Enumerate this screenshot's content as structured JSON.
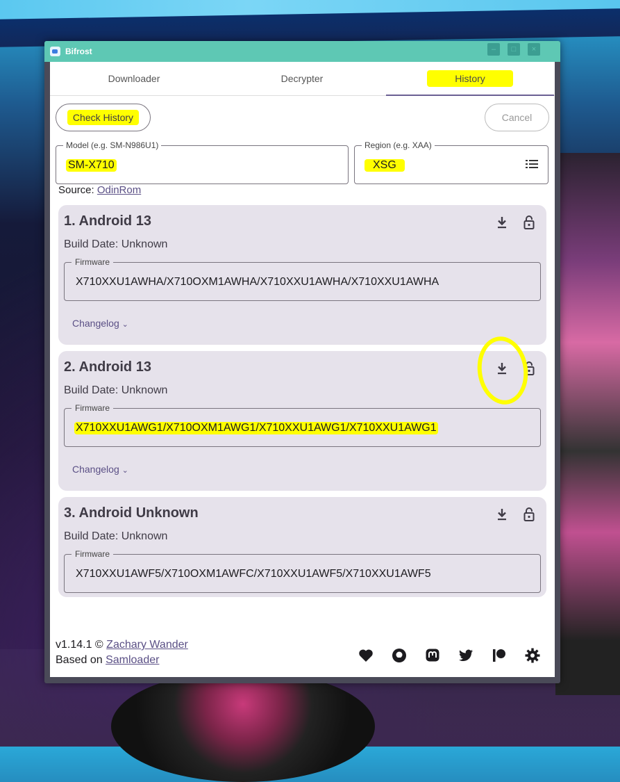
{
  "window": {
    "title": "Bifrost",
    "controls": [
      "minimize",
      "maximize",
      "close"
    ]
  },
  "tabs": [
    {
      "label": "Downloader"
    },
    {
      "label": "Decrypter"
    },
    {
      "label": "History",
      "active": true
    }
  ],
  "actions": {
    "check_history": "Check History",
    "cancel": "Cancel"
  },
  "model_field": {
    "legend": "Model (e.g. SM-N986U1)",
    "value": "SM-X710"
  },
  "region_field": {
    "legend": "Region (e.g. XAA)",
    "value": "XSG",
    "icon": "list-icon"
  },
  "source": {
    "label": "Source:",
    "link": "OdinRom"
  },
  "results": [
    {
      "title": "1. Android 13",
      "build_date": "Build Date: Unknown",
      "firmware_legend": "Firmware",
      "firmware": "X710XXU1AWHA/X710OXM1AWHA/X710XXU1AWHA/X710XXU1AWHA",
      "changelog": "Changelog"
    },
    {
      "title": "2. Android 13",
      "build_date": "Build Date: Unknown",
      "firmware_legend": "Firmware",
      "firmware": "X710XXU1AWG1/X710OXM1AWG1/X710XXU1AWG1/X710XXU1AWG1",
      "changelog": "Changelog"
    },
    {
      "title": "3. Android Unknown",
      "build_date": "Build Date: Unknown",
      "firmware_legend": "Firmware",
      "firmware": "X710XXU1AWF5/X710OXM1AWFC/X710XXU1AWF5/X710XXU1AWF5"
    }
  ],
  "footer": {
    "version": "v1.14.1 ©",
    "author": "Zachary Wander",
    "based_on": "Based on",
    "samloader": "Samloader",
    "icons": [
      "heart-icon",
      "github-icon",
      "mastodon-icon",
      "twitter-icon",
      "patreon-icon",
      "settings-icon"
    ]
  },
  "colors": {
    "titlebar": "#5ec8b4",
    "accent": "#6a5f93",
    "card": "#e6e2eb",
    "highlight": "#ffff00"
  }
}
